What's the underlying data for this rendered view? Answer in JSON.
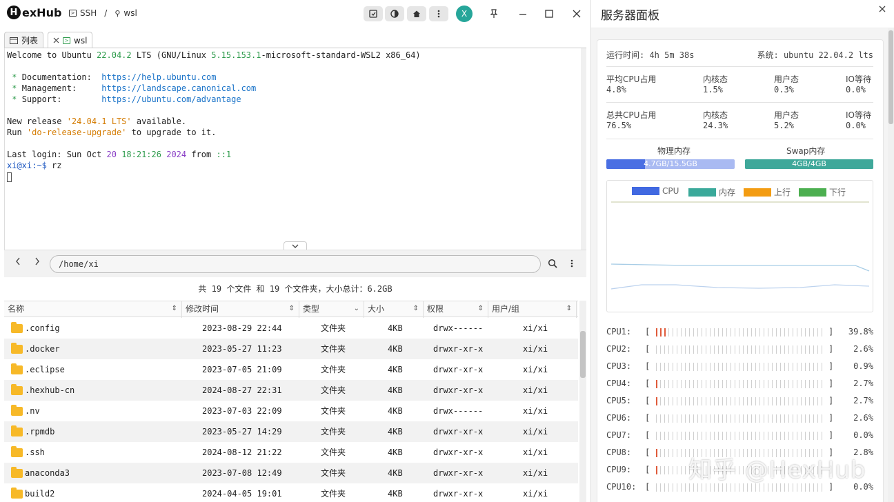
{
  "app": {
    "logo_letter": "H",
    "logo_text": "exHub"
  },
  "breadcrumb": {
    "ssh_label": "SSH",
    "separator": "/",
    "host_label": "wsl"
  },
  "header": {
    "avatar_letter": "X"
  },
  "tabs": [
    {
      "label": "列表"
    },
    {
      "label": "wsl"
    }
  ],
  "terminal": {
    "line1": {
      "a": "Welcome to Ubuntu ",
      "b": "22.04.2",
      "c": " LTS (GNU/Linux ",
      "d": "5.15.153.1",
      "e": "-microsoft-standard-WSL2 x86_64)"
    },
    "doc": {
      "label": "Documentation:  ",
      "url": "https://help.ubuntu.com"
    },
    "mgmt": {
      "label": "Management:     ",
      "url": "https://landscape.canonical.com"
    },
    "support": {
      "label": "Support:        ",
      "url": "https://ubuntu.com/advantage"
    },
    "release": {
      "a": "New release ",
      "b": "'24.04.1 LTS'",
      "c": " available."
    },
    "upgrade": {
      "a": "Run ",
      "b": "'do-release-upgrade'",
      "c": " to upgrade to it."
    },
    "login": {
      "a": "Last login: Sun Oct ",
      "b": "20",
      "c": " ",
      "d": "18:21:26",
      "e": " ",
      "f": "2024",
      "g": " from ",
      "h": "::1"
    },
    "prompt": {
      "user": "xi@xi",
      "path": ":~$",
      "cmd": " rz"
    }
  },
  "file_browser": {
    "path": "/home/xi",
    "summary": "共 19 个文件 和 19 个文件夹，大小总计：6.2GB",
    "columns": [
      "名称",
      "修改时间",
      "类型",
      "大小",
      "权限",
      "用户/组"
    ],
    "rows": [
      {
        "name": ".config",
        "modified": "2023-08-29 22:44",
        "type": "文件夹",
        "size": "4KB",
        "perm": "drwx------",
        "owner": "xi/xi"
      },
      {
        "name": ".docker",
        "modified": "2023-05-27 11:23",
        "type": "文件夹",
        "size": "4KB",
        "perm": "drwxr-xr-x",
        "owner": "xi/xi"
      },
      {
        "name": ".eclipse",
        "modified": "2023-07-05 21:09",
        "type": "文件夹",
        "size": "4KB",
        "perm": "drwxr-xr-x",
        "owner": "xi/xi"
      },
      {
        "name": ".hexhub-cn",
        "modified": "2024-08-27 22:31",
        "type": "文件夹",
        "size": "4KB",
        "perm": "drwxr-xr-x",
        "owner": "xi/xi"
      },
      {
        "name": ".nv",
        "modified": "2023-07-03 22:09",
        "type": "文件夹",
        "size": "4KB",
        "perm": "drwx------",
        "owner": "xi/xi"
      },
      {
        "name": ".rpmdb",
        "modified": "2023-05-27 14:29",
        "type": "文件夹",
        "size": "4KB",
        "perm": "drwxr-xr-x",
        "owner": "xi/xi"
      },
      {
        "name": ".ssh",
        "modified": "2024-08-12 21:22",
        "type": "文件夹",
        "size": "4KB",
        "perm": "drwxr-xr-x",
        "owner": "xi/xi"
      },
      {
        "name": "anaconda3",
        "modified": "2023-07-08 12:49",
        "type": "文件夹",
        "size": "4KB",
        "perm": "drwxr-xr-x",
        "owner": "xi/xi"
      },
      {
        "name": "build2",
        "modified": "2024-04-05 19:01",
        "type": "文件夹",
        "size": "4KB",
        "perm": "drwxr-xr-x",
        "owner": "xi/xi"
      }
    ]
  },
  "server_panel": {
    "title": "服务器面板",
    "uptime": "运行时间: 4h 5m 38s",
    "system": "系统: ubuntu 22.04.2 lts",
    "avg_cpu": {
      "label": "平均CPU占用",
      "value": "4.8%",
      "kernel_label": "内核态",
      "kernel": "1.5%",
      "user_label": "用户态",
      "user": "0.3%",
      "io_label": "IO等待",
      "io": "0.0%"
    },
    "total_cpu": {
      "label": "总共CPU占用",
      "value": "76.5%",
      "kernel_label": "内核态",
      "kernel": "24.3%",
      "user_label": "用户态",
      "user": "5.2%",
      "io_label": "IO等待",
      "io": "0.0%"
    },
    "memory": {
      "label": "物理内存",
      "value": "4.7GB/15.5GB",
      "used_fraction": 0.3,
      "color": "#4a6fe3",
      "track": "#a9baf2"
    },
    "swap": {
      "label": "Swap内存",
      "value": "4GB/4GB",
      "used_fraction": 1.0,
      "color": "#3fa89a"
    },
    "net_legend": [
      {
        "name": "CPU",
        "color": "#4169e1"
      },
      {
        "name": "内存",
        "color": "#3aa99a"
      },
      {
        "name": "上行",
        "color": "#f39c12"
      },
      {
        "name": "下行",
        "color": "#4caf50"
      }
    ],
    "cpus": [
      {
        "label": "CPU1:",
        "percent": "39.8%",
        "level": 0.398
      },
      {
        "label": "CPU2:",
        "percent": "2.6%",
        "level": 0.0
      },
      {
        "label": "CPU3:",
        "percent": "0.9%",
        "level": 0.0
      },
      {
        "label": "CPU4:",
        "percent": "2.7%",
        "level": 0.027
      },
      {
        "label": "CPU5:",
        "percent": "2.7%",
        "level": 0.027
      },
      {
        "label": "CPU6:",
        "percent": "2.6%",
        "level": 0.0
      },
      {
        "label": "CPU7:",
        "percent": "0.0%",
        "level": 0.0
      },
      {
        "label": "CPU8:",
        "percent": "2.8%",
        "level": 0.028
      },
      {
        "label": "CPU9:",
        "percent": "",
        "level": 0.03
      },
      {
        "label": "CPU10:",
        "percent": "0.0%",
        "level": 0.0
      }
    ]
  },
  "watermark": "知乎 @HexHub"
}
